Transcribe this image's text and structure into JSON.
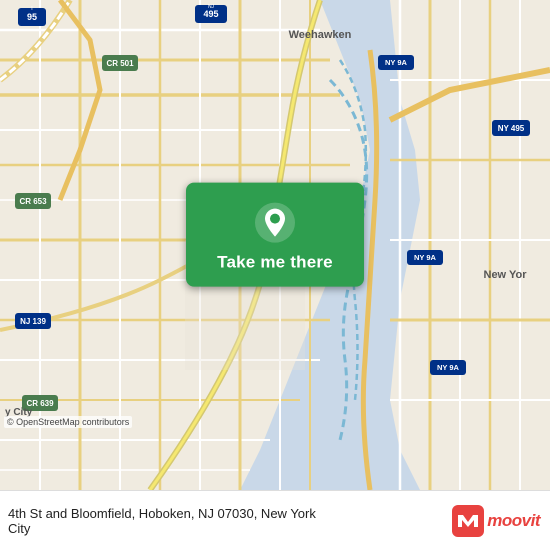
{
  "map": {
    "attribution": "© OpenStreetMap contributors"
  },
  "button": {
    "label": "Take me there"
  },
  "address": {
    "line1": "4th St and Bloomfield, Hoboken, NJ 07030, New York",
    "line2": "City"
  },
  "moovit": {
    "logo_text": "moovit"
  }
}
